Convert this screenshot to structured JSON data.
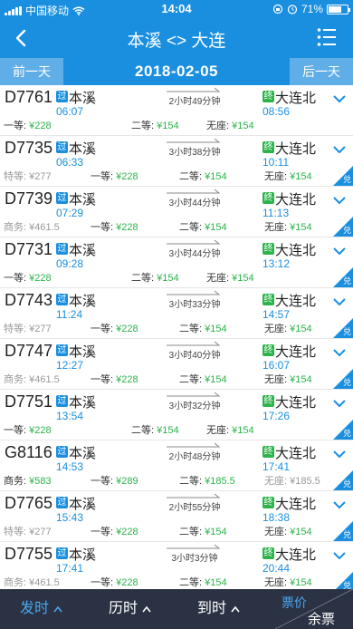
{
  "status": {
    "carrier": "中国移动",
    "time": "14:04",
    "battery": "71%",
    "battery_level": 0.71
  },
  "header": {
    "title": "本溪 <> 大连",
    "back_icon": "back-chevron-icon",
    "menu_icon": "filter-menu-icon"
  },
  "datebar": {
    "prev": "前一天",
    "date": "2018-02-05",
    "next": "后一天"
  },
  "colors": {
    "primary": "#1a8fe0",
    "green": "#2cb34a",
    "dark": "#2a3244"
  },
  "trains": [
    {
      "no": "D7761",
      "from": "本溪",
      "dep": "06:07",
      "dur": "2小时49分钟",
      "to": "大连北",
      "arr": "08:56",
      "dui": false,
      "seats": [
        {
          "label": "一等: ",
          "price": "¥228",
          "gray": false
        },
        {
          "label": "二等: ",
          "price": "¥154",
          "gray": false
        },
        {
          "label": "无座: ",
          "price": "¥154",
          "gray": false
        }
      ]
    },
    {
      "no": "D7735",
      "from": "本溪",
      "dep": "06:33",
      "dur": "3小时38分钟",
      "to": "大连北",
      "arr": "10:11",
      "dui": true,
      "seats": [
        {
          "label": "特等: ",
          "price": "¥277",
          "gray": true
        },
        {
          "label": "一等: ",
          "price": "¥228",
          "gray": false
        },
        {
          "label": "二等: ",
          "price": "¥154",
          "gray": false
        },
        {
          "label": "无座: ",
          "price": "¥154",
          "gray": false
        }
      ]
    },
    {
      "no": "D7739",
      "from": "本溪",
      "dep": "07:29",
      "dur": "3小时44分钟",
      "to": "大连北",
      "arr": "11:13",
      "dui": true,
      "seats": [
        {
          "label": "商务: ",
          "price": "¥461.5",
          "gray": true
        },
        {
          "label": "一等: ",
          "price": "¥228",
          "gray": false
        },
        {
          "label": "二等: ",
          "price": "¥154",
          "gray": false
        },
        {
          "label": "无座: ",
          "price": "¥154",
          "gray": false
        }
      ]
    },
    {
      "no": "D7731",
      "from": "本溪",
      "dep": "09:28",
      "dur": "3小时44分钟",
      "to": "大连北",
      "arr": "13:12",
      "dui": true,
      "seats": [
        {
          "label": "一等: ",
          "price": "¥228",
          "gray": false
        },
        {
          "label": "二等: ",
          "price": "¥154",
          "gray": false
        },
        {
          "label": "无座: ",
          "price": "¥154",
          "gray": false
        }
      ]
    },
    {
      "no": "D7743",
      "from": "本溪",
      "dep": "11:24",
      "dur": "3小时33分钟",
      "to": "大连北",
      "arr": "14:57",
      "dui": true,
      "seats": [
        {
          "label": "特等: ",
          "price": "¥277",
          "gray": true
        },
        {
          "label": "一等: ",
          "price": "¥228",
          "gray": false
        },
        {
          "label": "二等: ",
          "price": "¥154",
          "gray": false
        },
        {
          "label": "无座: ",
          "price": "¥154",
          "gray": false
        }
      ]
    },
    {
      "no": "D7747",
      "from": "本溪",
      "dep": "12:27",
      "dur": "3小时40分钟",
      "to": "大连北",
      "arr": "16:07",
      "dui": true,
      "seats": [
        {
          "label": "商务: ",
          "price": "¥461.5",
          "gray": true
        },
        {
          "label": "一等: ",
          "price": "¥228",
          "gray": false
        },
        {
          "label": "二等: ",
          "price": "¥154",
          "gray": false
        },
        {
          "label": "无座: ",
          "price": "¥154",
          "gray": false
        }
      ]
    },
    {
      "no": "D7751",
      "from": "本溪",
      "dep": "13:54",
      "dur": "3小时32分钟",
      "to": "大连北",
      "arr": "17:26",
      "dui": true,
      "seats": [
        {
          "label": "一等: ",
          "price": "¥228",
          "gray": false
        },
        {
          "label": "二等: ",
          "price": "¥154",
          "gray": false
        },
        {
          "label": "无座: ",
          "price": "¥154",
          "gray": false
        }
      ]
    },
    {
      "no": "G8116",
      "from": "本溪",
      "dep": "14:53",
      "dur": "2小时48分钟",
      "to": "大连北",
      "arr": "17:41",
      "dui": true,
      "seats": [
        {
          "label": "商务: ",
          "price": "¥583",
          "gray": false
        },
        {
          "label": "一等: ",
          "price": "¥289",
          "gray": false
        },
        {
          "label": "二等: ",
          "price": "¥185.5",
          "gray": false
        },
        {
          "label": "无座: ",
          "price": "¥185.5",
          "gray": true
        }
      ]
    },
    {
      "no": "D7765",
      "from": "本溪",
      "dep": "15:43",
      "dur": "2小时55分钟",
      "to": "大连北",
      "arr": "18:38",
      "dui": true,
      "seats": [
        {
          "label": "特等: ",
          "price": "¥277",
          "gray": true
        },
        {
          "label": "一等: ",
          "price": "¥228",
          "gray": false
        },
        {
          "label": "二等: ",
          "price": "¥154",
          "gray": false
        },
        {
          "label": "无座: ",
          "price": "¥154",
          "gray": false
        }
      ]
    },
    {
      "no": "D7755",
      "from": "本溪",
      "dep": "17:41",
      "dur": "3小时3分钟",
      "to": "大连北",
      "arr": "20:44",
      "dui": true,
      "seats": [
        {
          "label": "商务: ",
          "price": "¥461.5",
          "gray": true
        },
        {
          "label": "一等: ",
          "price": "¥228",
          "gray": false
        },
        {
          "label": "二等: ",
          "price": "¥154",
          "gray": false
        },
        {
          "label": "无座: ",
          "price": "¥154",
          "gray": false
        }
      ]
    }
  ],
  "badges": {
    "pass": "过",
    "term": "终",
    "dui": "兑"
  },
  "bottom": {
    "depart": "发时",
    "duration": "历时",
    "arrive": "到时",
    "price": "票价",
    "remaining": "余票"
  }
}
